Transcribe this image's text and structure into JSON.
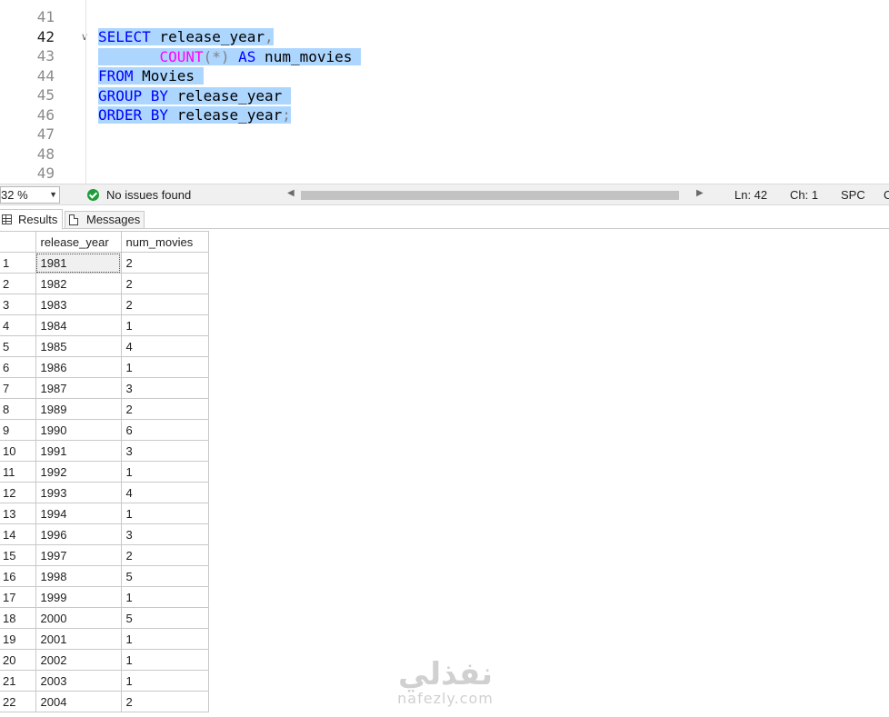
{
  "editor": {
    "line_numbers": [
      "41",
      "42",
      "43",
      "44",
      "45",
      "46",
      "47",
      "48",
      "49"
    ],
    "current_line": "42",
    "code_lines": [
      [
        {
          "t": "SELECT",
          "c": "kw"
        },
        {
          "t": " release_year",
          "c": "id"
        },
        {
          "t": ",",
          "c": "op"
        }
      ],
      [
        {
          "t": "       ",
          "c": "id"
        },
        {
          "t": "COUNT",
          "c": "fn"
        },
        {
          "t": "(*)",
          "c": "op"
        },
        {
          "t": " ",
          "c": "id"
        },
        {
          "t": "AS",
          "c": "kw"
        },
        {
          "t": " num_movies ",
          "c": "id"
        }
      ],
      [
        {
          "t": "FROM",
          "c": "kw"
        },
        {
          "t": " Movies ",
          "c": "id"
        }
      ],
      [
        {
          "t": "GROUP BY",
          "c": "kw"
        },
        {
          "t": " release_year ",
          "c": "id"
        }
      ],
      [
        {
          "t": "ORDER BY",
          "c": "kw"
        },
        {
          "t": " release_year",
          "c": "id"
        },
        {
          "t": ";",
          "c": "op"
        }
      ]
    ]
  },
  "status": {
    "zoom": "32 %",
    "issues": "No issues found",
    "line": "Ln: 42",
    "col": "Ch: 1",
    "mode": "SPC",
    "extra": "C"
  },
  "tabs": {
    "results": "Results",
    "messages": "Messages"
  },
  "grid": {
    "columns": [
      "release_year",
      "num_movies"
    ],
    "rows": [
      [
        "1",
        "1981",
        "2"
      ],
      [
        "2",
        "1982",
        "2"
      ],
      [
        "3",
        "1983",
        "2"
      ],
      [
        "4",
        "1984",
        "1"
      ],
      [
        "5",
        "1985",
        "4"
      ],
      [
        "6",
        "1986",
        "1"
      ],
      [
        "7",
        "1987",
        "3"
      ],
      [
        "8",
        "1989",
        "2"
      ],
      [
        "9",
        "1990",
        "6"
      ],
      [
        "10",
        "1991",
        "3"
      ],
      [
        "11",
        "1992",
        "1"
      ],
      [
        "12",
        "1993",
        "4"
      ],
      [
        "13",
        "1994",
        "1"
      ],
      [
        "14",
        "1996",
        "3"
      ],
      [
        "15",
        "1997",
        "2"
      ],
      [
        "16",
        "1998",
        "5"
      ],
      [
        "17",
        "1999",
        "1"
      ],
      [
        "18",
        "2000",
        "5"
      ],
      [
        "19",
        "2001",
        "1"
      ],
      [
        "20",
        "2002",
        "1"
      ],
      [
        "21",
        "2003",
        "1"
      ],
      [
        "22",
        "2004",
        "2"
      ]
    ]
  },
  "watermark": {
    "arabic": "نفذلي",
    "latin": "nafezly.com"
  }
}
